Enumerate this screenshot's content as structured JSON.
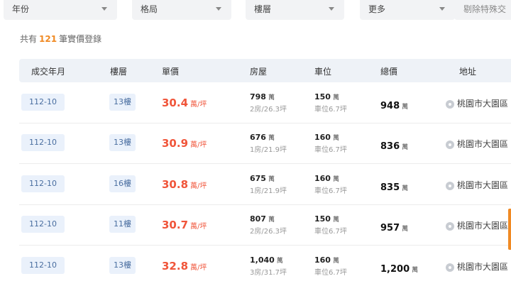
{
  "filters": [
    {
      "label": "年份"
    },
    {
      "label": "格局"
    },
    {
      "label": "樓層"
    },
    {
      "label": "更多"
    },
    {
      "label": "剔除特殊交"
    }
  ],
  "summary": {
    "prefix": "共有",
    "count": "121",
    "suffix": "筆實價登錄"
  },
  "columns": [
    "成交年月",
    "樓層",
    "單價",
    "房屋",
    "車位",
    "總價",
    "地址"
  ],
  "unit_price_unit": "萬/坪",
  "wan": "萬",
  "rows": [
    {
      "date": "112-10",
      "floor": "13樓",
      "unit_price": "30.4",
      "house_price": "798",
      "house_detail": "2房/26.3坪",
      "parking_price": "150",
      "parking_detail": "車位6.7坪",
      "total": "948",
      "address": "桃園市大園區"
    },
    {
      "date": "112-10",
      "floor": "13樓",
      "unit_price": "30.9",
      "house_price": "676",
      "house_detail": "1房/21.9坪",
      "parking_price": "160",
      "parking_detail": "車位6.7坪",
      "total": "836",
      "address": "桃園市大園區"
    },
    {
      "date": "112-10",
      "floor": "16樓",
      "unit_price": "30.8",
      "house_price": "675",
      "house_detail": "1房/21.9坪",
      "parking_price": "160",
      "parking_detail": "車位6.7坪",
      "total": "835",
      "address": "桃園市大園區"
    },
    {
      "date": "112-10",
      "floor": "11樓",
      "unit_price": "30.7",
      "house_price": "807",
      "house_detail": "2房/26.3坪",
      "parking_price": "150",
      "parking_detail": "車位6.7坪",
      "total": "957",
      "address": "桃園市大園區"
    },
    {
      "date": "112-10",
      "floor": "13樓",
      "unit_price": "32.8",
      "house_price": "1,040",
      "house_detail": "3房/31.7坪",
      "parking_price": "160",
      "parking_detail": "車位6.7坪",
      "total": "1,200",
      "address": "桃園市大園區"
    }
  ],
  "colors": {
    "accent": "#f08a24",
    "price": "#f0553a",
    "tag_bg": "#eaf1fb"
  },
  "icons": {
    "dropdown": "chevron-down-icon",
    "address": "location-pin-icon"
  }
}
